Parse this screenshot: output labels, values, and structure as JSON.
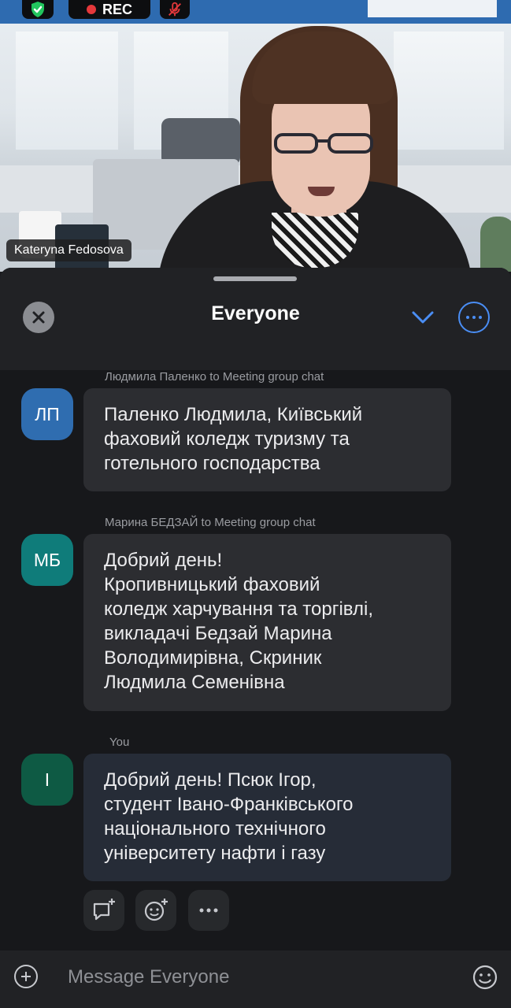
{
  "video": {
    "recording_label": "REC",
    "participant_name": "Kateryna Fedosova"
  },
  "chat": {
    "header_title": "Everyone",
    "messages": [
      {
        "meta": "Людмила Паленко to Meeting group chat",
        "avatar_initials": "ЛП",
        "avatar_color": "#2f6db0",
        "lines": [
          "Паленко Людмила, Київський",
          "фаховий коледж туризму та",
          "готельного господарства"
        ]
      },
      {
        "meta": "Марина БЕДЗАЙ to Meeting group chat",
        "avatar_initials": "МБ",
        "avatar_color": "#0f7c7a",
        "lines": [
          "Добрий день!",
          "Кропивницький фаховий",
          "коледж харчування та торгівлі,",
          "викладачі Бедзай Марина",
          "Володимирівна, Скриник",
          "Людмила Семенівна"
        ]
      },
      {
        "meta": "You",
        "avatar_initials": "I",
        "avatar_color": "#0e5a44",
        "lines": [
          "Добрий день! Псюк Ігор,",
          "студент Івано-Франківського",
          "національного технічного",
          "університету нафти і газу"
        ]
      }
    ]
  },
  "composer": {
    "placeholder": "Message Everyone"
  },
  "colors": {
    "accent": "#4a8ef5",
    "recording": "#e5383b",
    "security": "#22c55e"
  }
}
